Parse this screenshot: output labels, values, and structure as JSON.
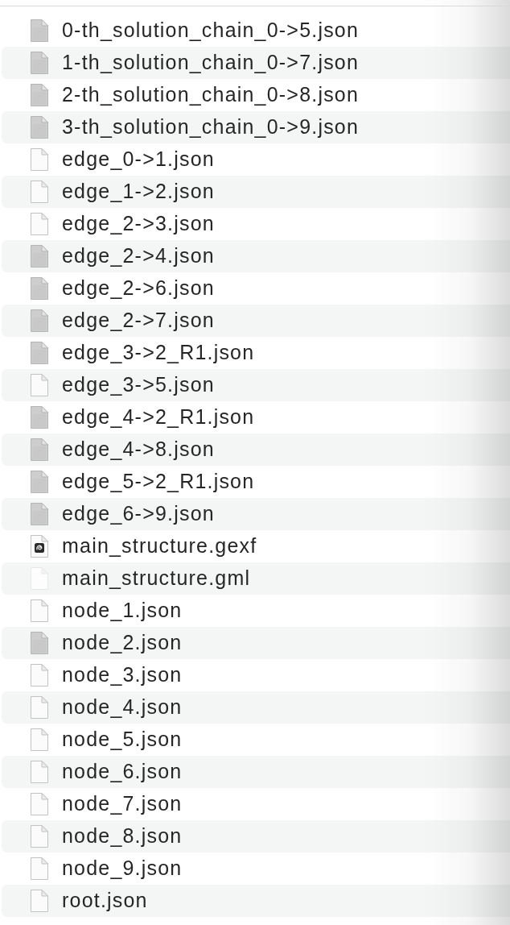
{
  "files": [
    {
      "name": "0-th_solution_chain_0->5.json",
      "kind": "preview"
    },
    {
      "name": "1-th_solution_chain_0->7.json",
      "kind": "preview"
    },
    {
      "name": "2-th_solution_chain_0->8.json",
      "kind": "preview"
    },
    {
      "name": "3-th_solution_chain_0->9.json",
      "kind": "preview"
    },
    {
      "name": "edge_0->1.json",
      "kind": "plain"
    },
    {
      "name": "edge_1->2.json",
      "kind": "plain"
    },
    {
      "name": "edge_2->3.json",
      "kind": "plain"
    },
    {
      "name": "edge_2->4.json",
      "kind": "preview"
    },
    {
      "name": "edge_2->6.json",
      "kind": "preview"
    },
    {
      "name": "edge_2->7.json",
      "kind": "preview"
    },
    {
      "name": "edge_3->2_R1.json",
      "kind": "preview"
    },
    {
      "name": "edge_3->5.json",
      "kind": "plain"
    },
    {
      "name": "edge_4->2_R1.json",
      "kind": "preview"
    },
    {
      "name": "edge_4->8.json",
      "kind": "preview"
    },
    {
      "name": "edge_5->2_R1.json",
      "kind": "preview"
    },
    {
      "name": "edge_6->9.json",
      "kind": "preview"
    },
    {
      "name": "main_structure.gexf",
      "kind": "logo"
    },
    {
      "name": "main_structure.gml",
      "kind": "faint"
    },
    {
      "name": "node_1.json",
      "kind": "plain"
    },
    {
      "name": "node_2.json",
      "kind": "preview"
    },
    {
      "name": "node_3.json",
      "kind": "plain"
    },
    {
      "name": "node_4.json",
      "kind": "plain"
    },
    {
      "name": "node_5.json",
      "kind": "plain"
    },
    {
      "name": "node_6.json",
      "kind": "plain"
    },
    {
      "name": "node_7.json",
      "kind": "plain"
    },
    {
      "name": "node_8.json",
      "kind": "plain"
    },
    {
      "name": "node_9.json",
      "kind": "plain"
    },
    {
      "name": "root.json",
      "kind": "plain"
    }
  ]
}
